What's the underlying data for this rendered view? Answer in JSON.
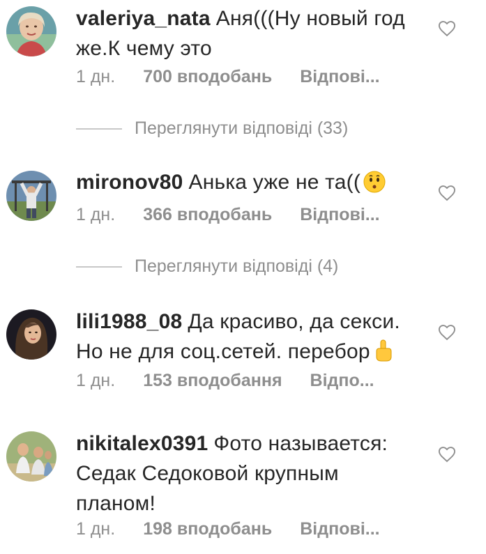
{
  "comments": [
    {
      "username": "valeriya_nata",
      "text": "Аня(((Ну новый год же.К чему это",
      "time": "1 дн.",
      "likes": "700 вподобань",
      "reply": "Відпові...",
      "avatar_icon": "woman-portrait-avatar"
    },
    {
      "username": "mironov80",
      "text": "Анька уже не та((",
      "emoji_icon": "kissing-face-emoji",
      "time": "1 дн.",
      "likes": "366 вподобань",
      "reply": "Відпові...",
      "avatar_icon": "man-outdoors-avatar"
    },
    {
      "username": "lili1988_08",
      "text": "Да красиво, да секси. Но не для соц.сетей. перебор",
      "emoji_icon": "pointing-up-emoji",
      "time": "1 дн.",
      "likes": "153 вподобання",
      "reply": "Відпо...",
      "avatar_icon": "woman-dark-avatar"
    },
    {
      "username": "nikitalex0391",
      "text": "Фото называется: Седак Седоковой крупным планом!",
      "time": "1 дн.",
      "likes": "198 вподобань",
      "reply": "Відпові...",
      "avatar_icon": "group-photo-avatar"
    }
  ],
  "view_replies": [
    {
      "label": "Переглянути відповіді (33)"
    },
    {
      "label": "Переглянути відповіді (4)"
    }
  ],
  "colors": {
    "text": "#262626",
    "meta": "#8e8e8e",
    "divider": "#c7c7c7",
    "background": "#ffffff"
  }
}
